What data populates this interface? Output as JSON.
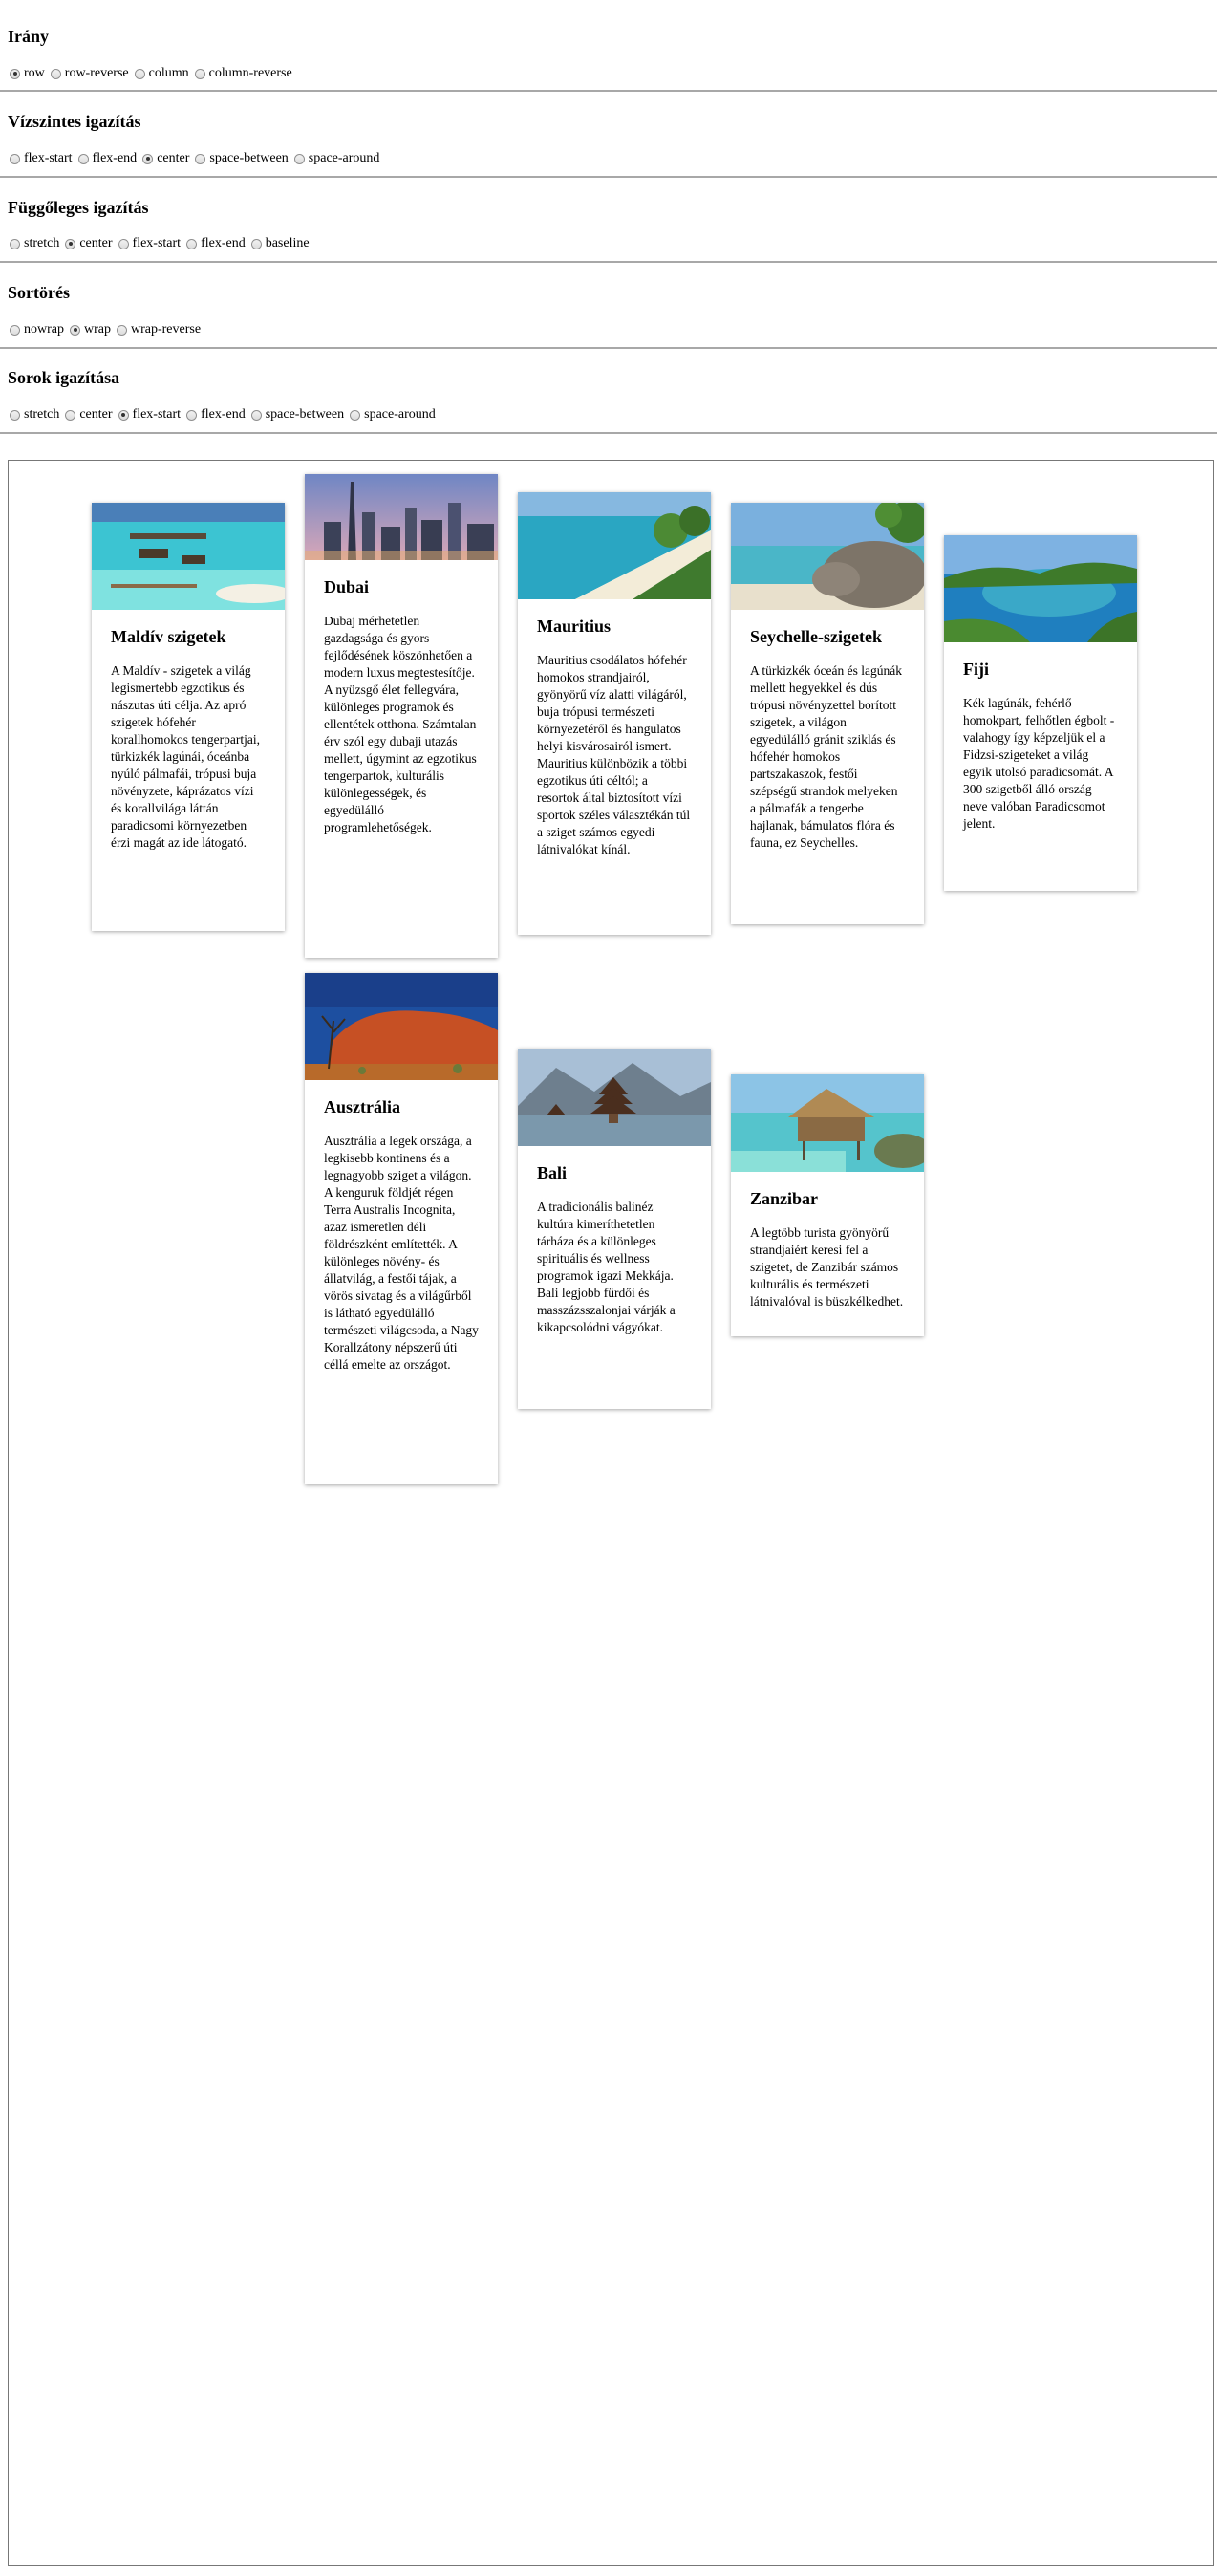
{
  "controls": [
    {
      "title": "Irány",
      "options": [
        "row",
        "row-reverse",
        "column",
        "column-reverse"
      ],
      "selected": "row"
    },
    {
      "title": "Vízszintes igazítás",
      "options": [
        "flex-start",
        "flex-end",
        "center",
        "space-between",
        "space-around"
      ],
      "selected": "center"
    },
    {
      "title": "Függőleges igazítás",
      "options": [
        "stretch",
        "center",
        "flex-start",
        "flex-end",
        "baseline"
      ],
      "selected": "center"
    },
    {
      "title": "Sortörés",
      "options": [
        "nowrap",
        "wrap",
        "wrap-reverse"
      ],
      "selected": "wrap"
    },
    {
      "title": "Sorok igazítása",
      "options": [
        "stretch",
        "center",
        "flex-start",
        "flex-end",
        "space-between",
        "space-around"
      ],
      "selected": "flex-start"
    }
  ],
  "cards": [
    {
      "title": "Maldív szigetek",
      "image": "maldives-photo",
      "text": "A Maldív - szigetek a világ legismertebb egzotikus és nászutas úti célja. Az apró szigetek hófehér korallhomokos tengerpartjai, türkizkék lagúnái, óceánba nyúló pálmafái, trópusi buja növényzete, káprázatos vízi és korallvilága láttán paradicsomi környezetben érzi magát az ide látogató."
    },
    {
      "title": "Dubai",
      "image": "dubai-skyline-photo",
      "text": "Dubaj mérhetetlen gazdagsága és gyors fejlődésének köszönhetően a modern luxus megtestesítője. A nyüzsgő élet fellegvára, különleges programok és ellentétek otthona. Számtalan érv szól egy dubaji utazás mellett, úgymint az egzotikus tengerpartok, kulturális különlegességek, és egyedülálló programlehetőségek."
    },
    {
      "title": "Mauritius",
      "image": "mauritius-beach-photo",
      "text": "Mauritius csodálatos hófehér homokos strandjairól, gyönyörű víz alatti világáról, buja trópusi természeti környezetéről és hangulatos helyi kisvárosairól ismert. Mauritius különbözik a többi egzotikus úti céltól; a resortok által biztosított vízi sportok széles választékán túl a sziget számos egyedi látnivalókat kínál."
    },
    {
      "title": "Seychelle-szigetek",
      "image": "seychelles-rocks-photo",
      "text": "A türkizkék óceán és lagúnák mellett hegyekkel és dús trópusi növényzettel borított szigetek, a világon egyedülálló gránit sziklás és hófehér homokos partszakaszok, festői szépségű strandok melyeken a pálmafák a tengerbe hajlanak, bámulatos flóra és fauna, ez Seychelles."
    },
    {
      "title": "Fiji",
      "image": "fiji-lagoon-photo",
      "text": "Kék lagúnák, fehérlő homokpart, felhőtlen égbolt - valahogy így képzeljük el a Fidzsi-szigeteket a világ egyik utolsó paradicsomát. A 300 szigetből álló ország neve valóban Paradicsomot jelent."
    },
    {
      "title": "Ausztrália",
      "image": "australia-uluru-photo",
      "text": "Ausztrália a legek országa, a legkisebb kontinens és a legnagyobb sziget a világon. A kenguruk földjét régen Terra Australis Incognita, azaz ismeretlen déli földrészként említették. A különleges növény- és állatvilág, a festői tájak, a vörös sivatag és a világűrből is látható egyedülálló természeti világcsoda, a Nagy Korallzátony népszerű úti céllá emelte az országot."
    },
    {
      "title": "Bali",
      "image": "bali-temple-photo",
      "text": "A tradicionális balinéz kultúra kimeríthetetlen tárháza és a különleges spirituális és wellness programok igazi Mekkája. Bali legjobb fürdői és masszázsszalonjai várják a kikapcsolódni vágyókat."
    },
    {
      "title": "Zanzibar",
      "image": "zanzibar-hut-photo",
      "text": "A legtöbb turista gyönyörű strandjaiért keresi fel a szigetet, de Zanzibár számos kulturális és természeti látnivalóval is büszkélkedhet."
    }
  ]
}
